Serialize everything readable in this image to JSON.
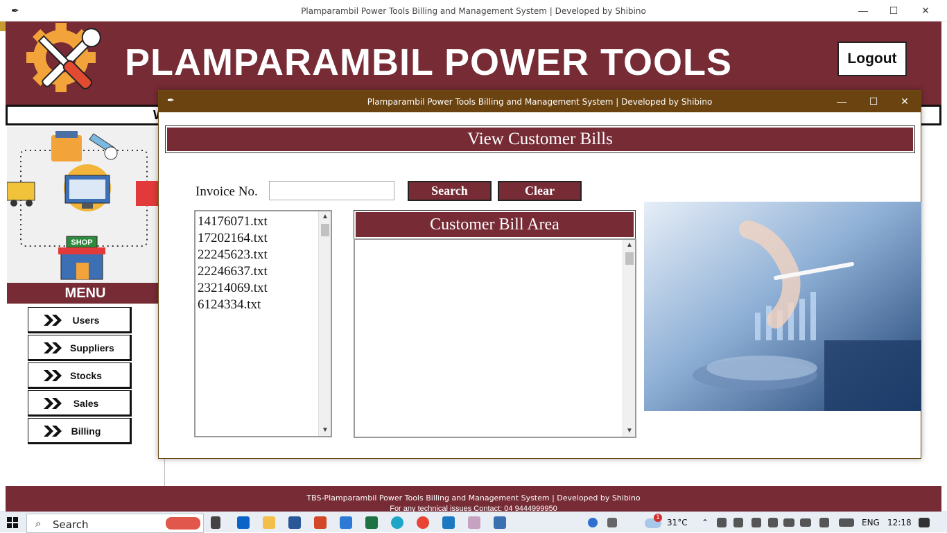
{
  "main_window": {
    "title": "Plamparambil Power Tools Billing and Management System |  Developed by Shibino",
    "brand": "PLAMPARAMBIL POWER TOOLS",
    "logout_label": "Logout",
    "welcome_partial": "W",
    "menu_title": "MENU",
    "menu_items": [
      {
        "label": "Users"
      },
      {
        "label": "Suppliers"
      },
      {
        "label": "Stocks"
      },
      {
        "label": "Sales"
      },
      {
        "label": "Billing"
      }
    ],
    "shop_sign": "SHOP",
    "footer_line1": "TBS-Plamparambil Power Tools Billing and Management System |  Developed by Shibino",
    "footer_line2": "For any technical issues Contact: 04 9444999950"
  },
  "dialog": {
    "title": "Plamparambil Power Tools Billing and Management System |  Developed by Shibino",
    "heading": "View Customer Bills",
    "invoice_label": "Invoice No.",
    "invoice_value": "",
    "search_label": "Search",
    "clear_label": "Clear",
    "bill_area_heading": "Customer Bill Area",
    "bill_content": "",
    "files": [
      "14176071.txt",
      "17202164.txt",
      "22245623.txt",
      "22246637.txt",
      "23214069.txt",
      "6124334.txt"
    ]
  },
  "taskbar": {
    "search_text": "Search",
    "weather": "31°C",
    "notification_count": "1",
    "language": "ENG",
    "time": "12:18"
  },
  "colors": {
    "brand_maroon": "#762b35",
    "dialog_titlebar": "#6b4311",
    "gear_orange": "#f2a33a"
  }
}
